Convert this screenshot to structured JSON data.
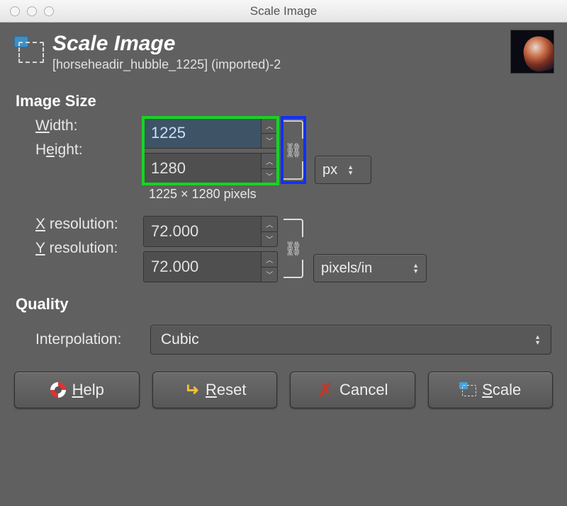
{
  "window": {
    "title": "Scale Image"
  },
  "header": {
    "title": "Scale Image",
    "subtitle": "[horseheadir_hubble_1225] (imported)-2"
  },
  "sections": {
    "image_size": "Image Size",
    "quality": "Quality"
  },
  "labels": {
    "width": "Width:",
    "height": "Height:",
    "xres": "X resolution:",
    "yres": "Y resolution:",
    "interpolation": "Interpolation:"
  },
  "size": {
    "width": "1225",
    "height": "1280",
    "note": "1225 × 1280 pixels",
    "unit": "px",
    "linked": true
  },
  "resolution": {
    "x": "72.000",
    "y": "72.000",
    "unit": "pixels/in",
    "linked": true
  },
  "interpolation": {
    "value": "Cubic"
  },
  "buttons": {
    "help": "Help",
    "reset": "Reset",
    "cancel": "Cancel",
    "scale": "Scale"
  }
}
